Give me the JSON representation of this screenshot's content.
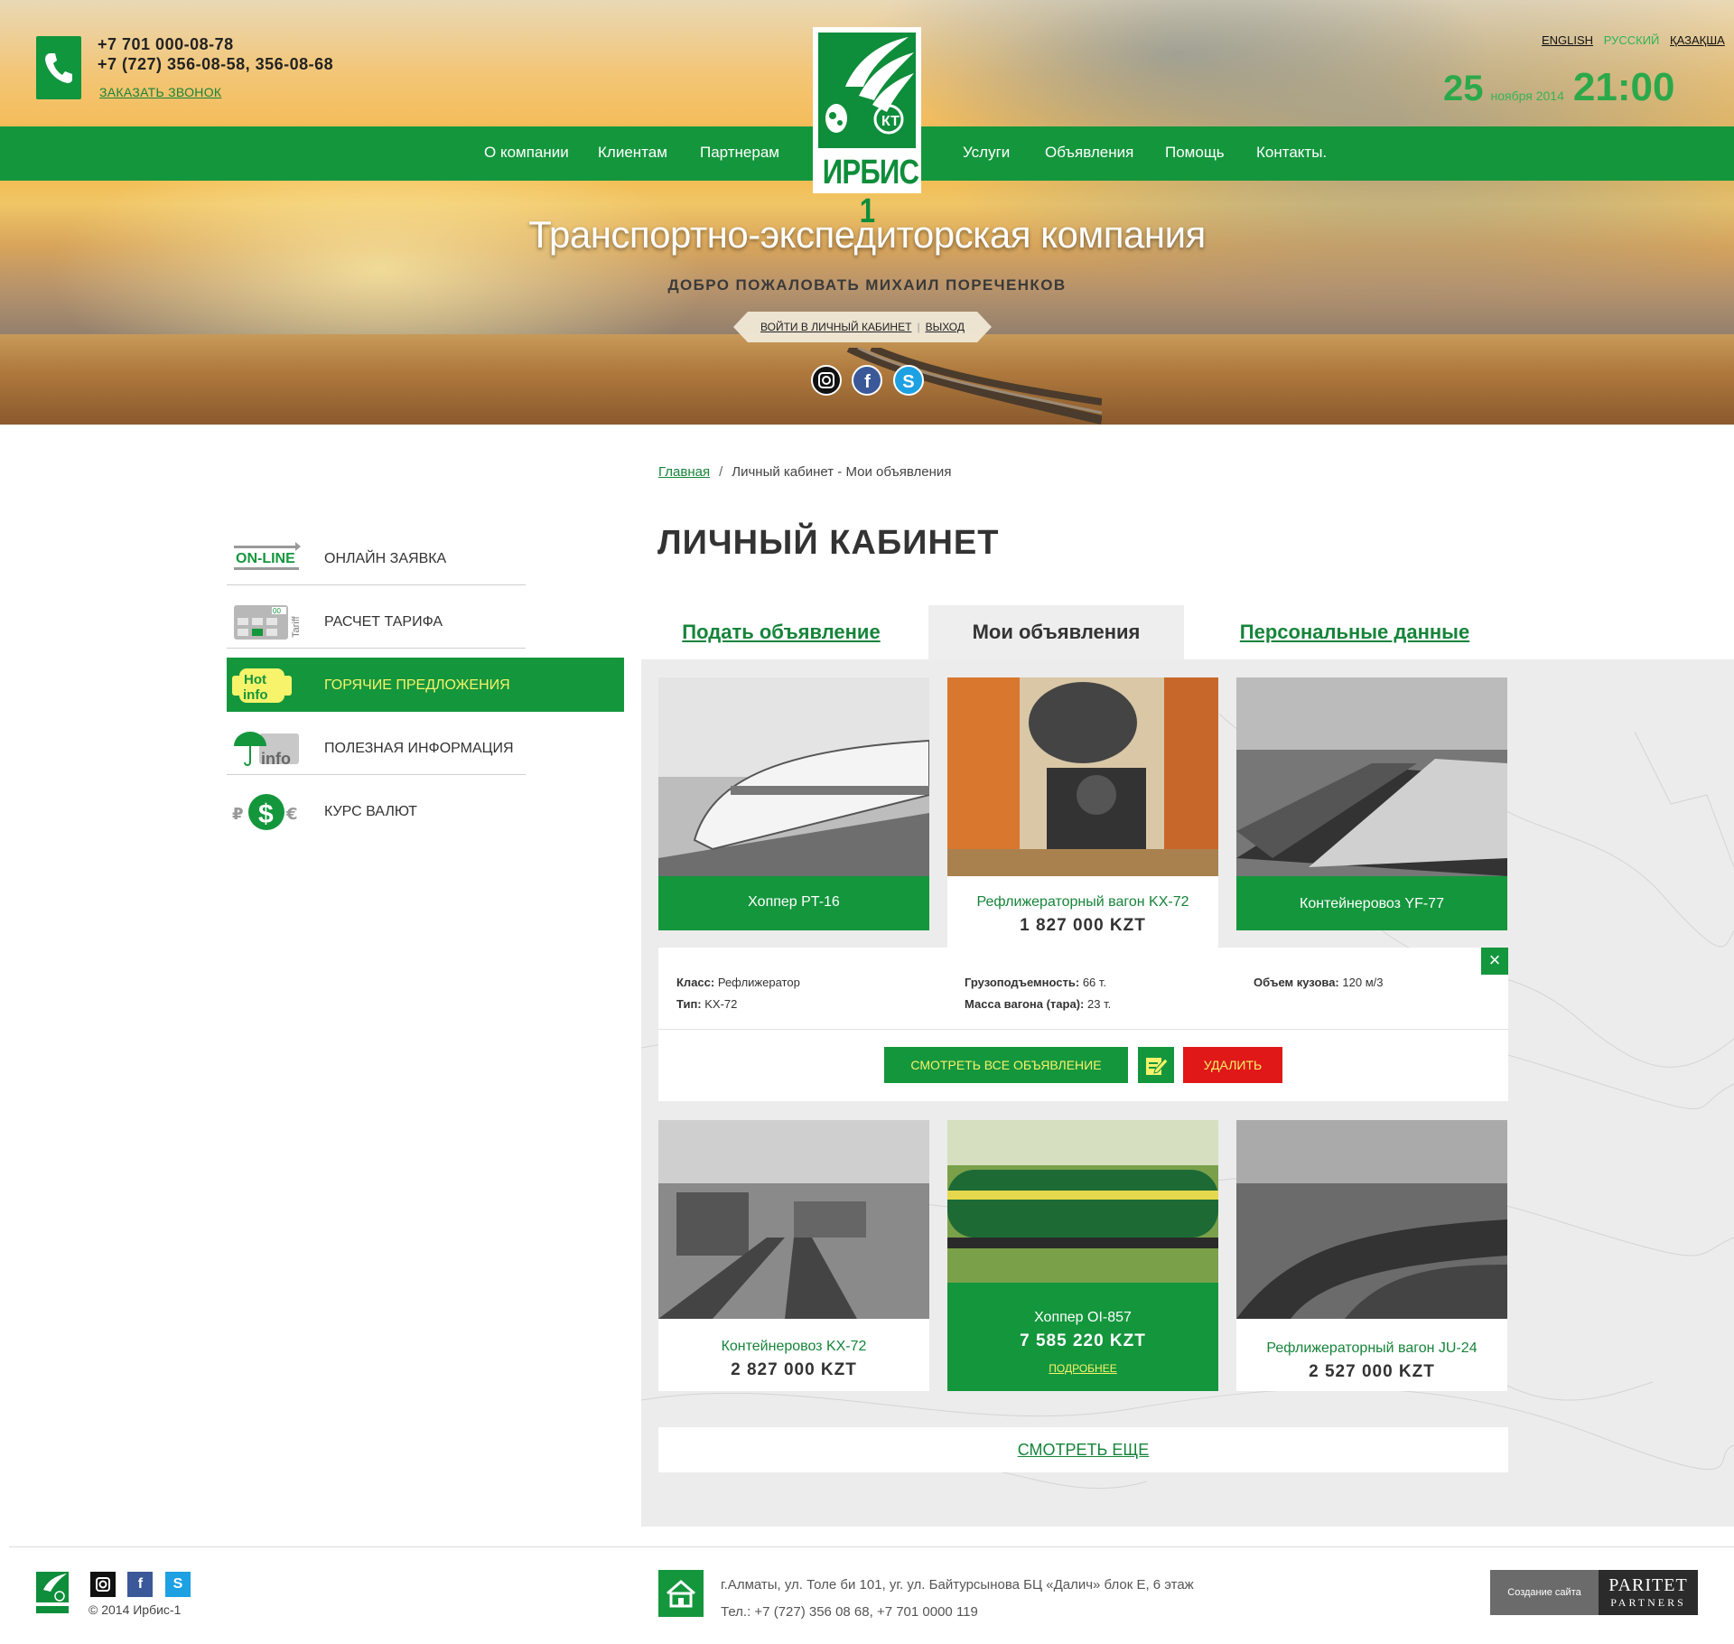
{
  "header": {
    "phones": [
      "+7 701 000-08-78",
      "+7 (727) 356-08-58, 356-08-68"
    ],
    "callback": "ЗАКАЗАТЬ ЗВОНОК",
    "languages": [
      {
        "label": "ENGLISH",
        "active": false
      },
      {
        "label": "РУССКИЙ",
        "active": true
      },
      {
        "label": "ҚАЗАҚША",
        "active": false
      }
    ],
    "date_day": "25",
    "date_month": "ноября 2014",
    "time": "21:00",
    "logo_text": "ИРБИС 1",
    "nav": [
      "О компании",
      "Клиентам",
      "Партнерам",
      "Услуги",
      "Объявления",
      "Помощь",
      "Контакты."
    ],
    "tagline": "Транспортно-экспедиторская компания",
    "welcome": "ДОБРО ПОЖАЛОВАТЬ МИХАИЛ ПОРЕЧЕНКОВ",
    "cabinet_link": "ВОЙТИ В ЛИЧНЫЙ КАБИНЕТ",
    "logout_link": "ВЫХОД",
    "socials": [
      "instagram-icon",
      "facebook-icon",
      "skype-icon"
    ]
  },
  "breadcrumb": {
    "home": "Главная",
    "current": "Личный кабинет  - Мои объявления"
  },
  "sidebar": [
    {
      "label": "ОНЛАЙН ЗАЯВКА",
      "icon": "online-icon",
      "icon_text": "ON-LINE",
      "active": false
    },
    {
      "label": "РАСЧЕТ ТАРИФА",
      "icon": "tariff-calculator-icon",
      "icon_text": "Tariff",
      "active": false
    },
    {
      "label": "ГОРЯЧИЕ ПРЕДЛОЖЕНИЯ",
      "icon": "hot-info-icon",
      "icon_text": "Hot info",
      "active": true
    },
    {
      "label": "ПОЛЕЗНАЯ ИНФОРМАЦИЯ",
      "icon": "info-umbrella-icon",
      "icon_text": "info",
      "active": false
    },
    {
      "label": "КУРС ВАЛЮТ",
      "icon": "currency-icon",
      "icon_text": "₽ $ €",
      "active": false
    }
  ],
  "main": {
    "title": "ЛИЧНЫЙ КАБИНЕТ",
    "tabs": [
      "Подать объявление",
      "Мои объявления",
      "Персональные данные"
    ],
    "active_tab": 1,
    "cards": [
      {
        "name": "Хоппер PT-16",
        "price": "",
        "style": "green"
      },
      {
        "name": "Рефлижераторный вагон KX-72",
        "price": "1 827 000  KZT",
        "style": "white"
      },
      {
        "name": "Контейнеровоз YF-77",
        "price": "",
        "style": "green"
      },
      {
        "name": "Контейнеровоз KX-72",
        "price": "2 827 000  KZT",
        "style": "white"
      },
      {
        "name": "Хоппер OI-857",
        "price": "7 585 220 KZT",
        "style": "green",
        "more": "ПОДРОБНЕЕ"
      },
      {
        "name": "Рефлижераторный вагон JU-24",
        "price": "2 527 000  KZT",
        "style": "white"
      }
    ],
    "detail": {
      "class_label": "Класс:",
      "class_value": "Рефлижератор",
      "type_label": "Тип:",
      "type_value": "KX-72",
      "capacity_label": "Грузоподъемность:",
      "capacity_value": "66 т.",
      "mass_label": "Масса вагона (тара):",
      "mass_value": "23 т.",
      "volume_label": "Объем кузова:",
      "volume_value": "120 м/3",
      "view_all": "СМОТРЕТЬ ВСЕ ОБЪЯВЛЕНИЕ",
      "delete": "УДАЛИТЬ"
    },
    "see_more": "СМОТРЕТЬ ЕЩЕ"
  },
  "footer": {
    "copyright": "© 2014  Ирбис-1",
    "address": "г.Алматы, ул. Толе би 101, уг. ул. Байтурсынова БЦ «Далич» блок Е, 6 этаж",
    "phones": "Тел.: +7 (727) 356 08 68, +7 701 0000 119",
    "maker_label": "Создание сайта",
    "maker_name_1": "PARITET",
    "maker_name_2": "PARTNERS"
  },
  "colors": {
    "brand_green": "#14963d",
    "accent_yellow": "#f7f36a",
    "delete_red": "#e01818"
  }
}
